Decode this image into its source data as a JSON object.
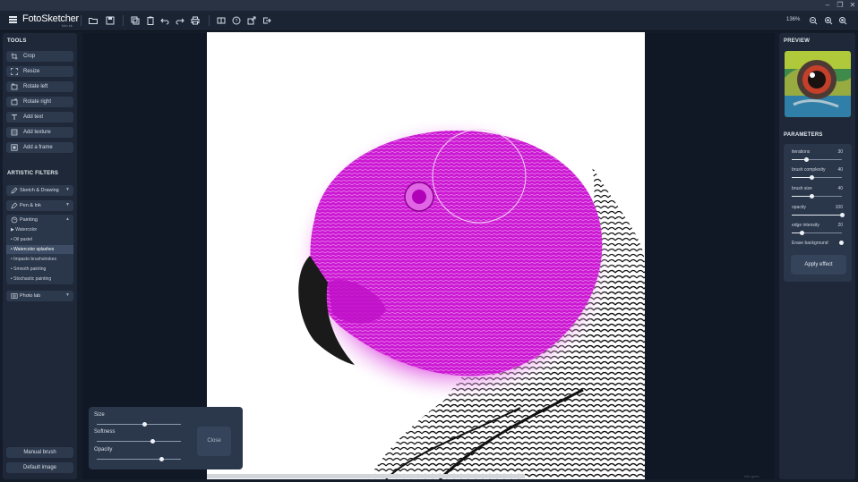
{
  "app": {
    "name": "FotoSketcher",
    "subtitle": "foto sk",
    "zoom": "136%"
  },
  "window_controls": [
    "–",
    "❐",
    "✕"
  ],
  "toolbar": {
    "icons": [
      "menu-icon",
      "open-folder-icon",
      "save-icon",
      "copy-icon",
      "paste-icon",
      "undo-icon",
      "redo-icon",
      "print-icon",
      "compare-icon",
      "help-icon",
      "share-icon",
      "exit-icon",
      "zoom-out-icon",
      "zoom-in-icon",
      "zoom-fit-icon"
    ]
  },
  "left": {
    "tools_title": "TOOLS",
    "tools": [
      {
        "label": "Crop",
        "icon": "crop-icon"
      },
      {
        "label": "Resize",
        "icon": "resize-icon"
      },
      {
        "label": "Rotate left",
        "icon": "rotate-left-icon"
      },
      {
        "label": "Rotate right",
        "icon": "rotate-right-icon"
      },
      {
        "label": "Add text",
        "icon": "text-icon"
      },
      {
        "label": "Add texture",
        "icon": "texture-icon"
      },
      {
        "label": "Add a frame",
        "icon": "frame-icon"
      }
    ],
    "filters_title": "ARTISTIC FILTERS",
    "filters": {
      "sketch": "Sketch & Drawing",
      "pen": "Pen & Ink",
      "painting": "Painting",
      "photo": "Photo lab"
    },
    "painting_items": [
      "▶ Watercolor",
      "• Oil pastel",
      "• Watercolor splashes",
      "• Impasto brushstrokes",
      "• Smooth painting",
      "• Stochastic painting"
    ],
    "manual_brush": "Manual brush",
    "default_image": "Default image"
  },
  "brush_popup": {
    "size_label": "Size",
    "softness_label": "Softness",
    "opacity_label": "Opacity",
    "close_label": "Close",
    "size": 0.57,
    "softness": 0.67,
    "opacity": 0.77
  },
  "right": {
    "preview_title": "PREVIEW",
    "parameters_title": "PARAMETERS",
    "params": [
      {
        "label": "iterations",
        "value": "30",
        "fraction": 0.29
      },
      {
        "label": "brush complexity",
        "value": "40",
        "fraction": 0.4
      },
      {
        "label": "brush size",
        "value": "40",
        "fraction": 0.4
      },
      {
        "label": "opacity",
        "value": "100",
        "fraction": 1.0
      },
      {
        "label": "edge intensity",
        "value": "20",
        "fraction": 0.2
      }
    ],
    "erase_label": "Erase background",
    "apply_label": "Apply effect"
  },
  "canvas": {
    "watermark": "foto goes"
  }
}
